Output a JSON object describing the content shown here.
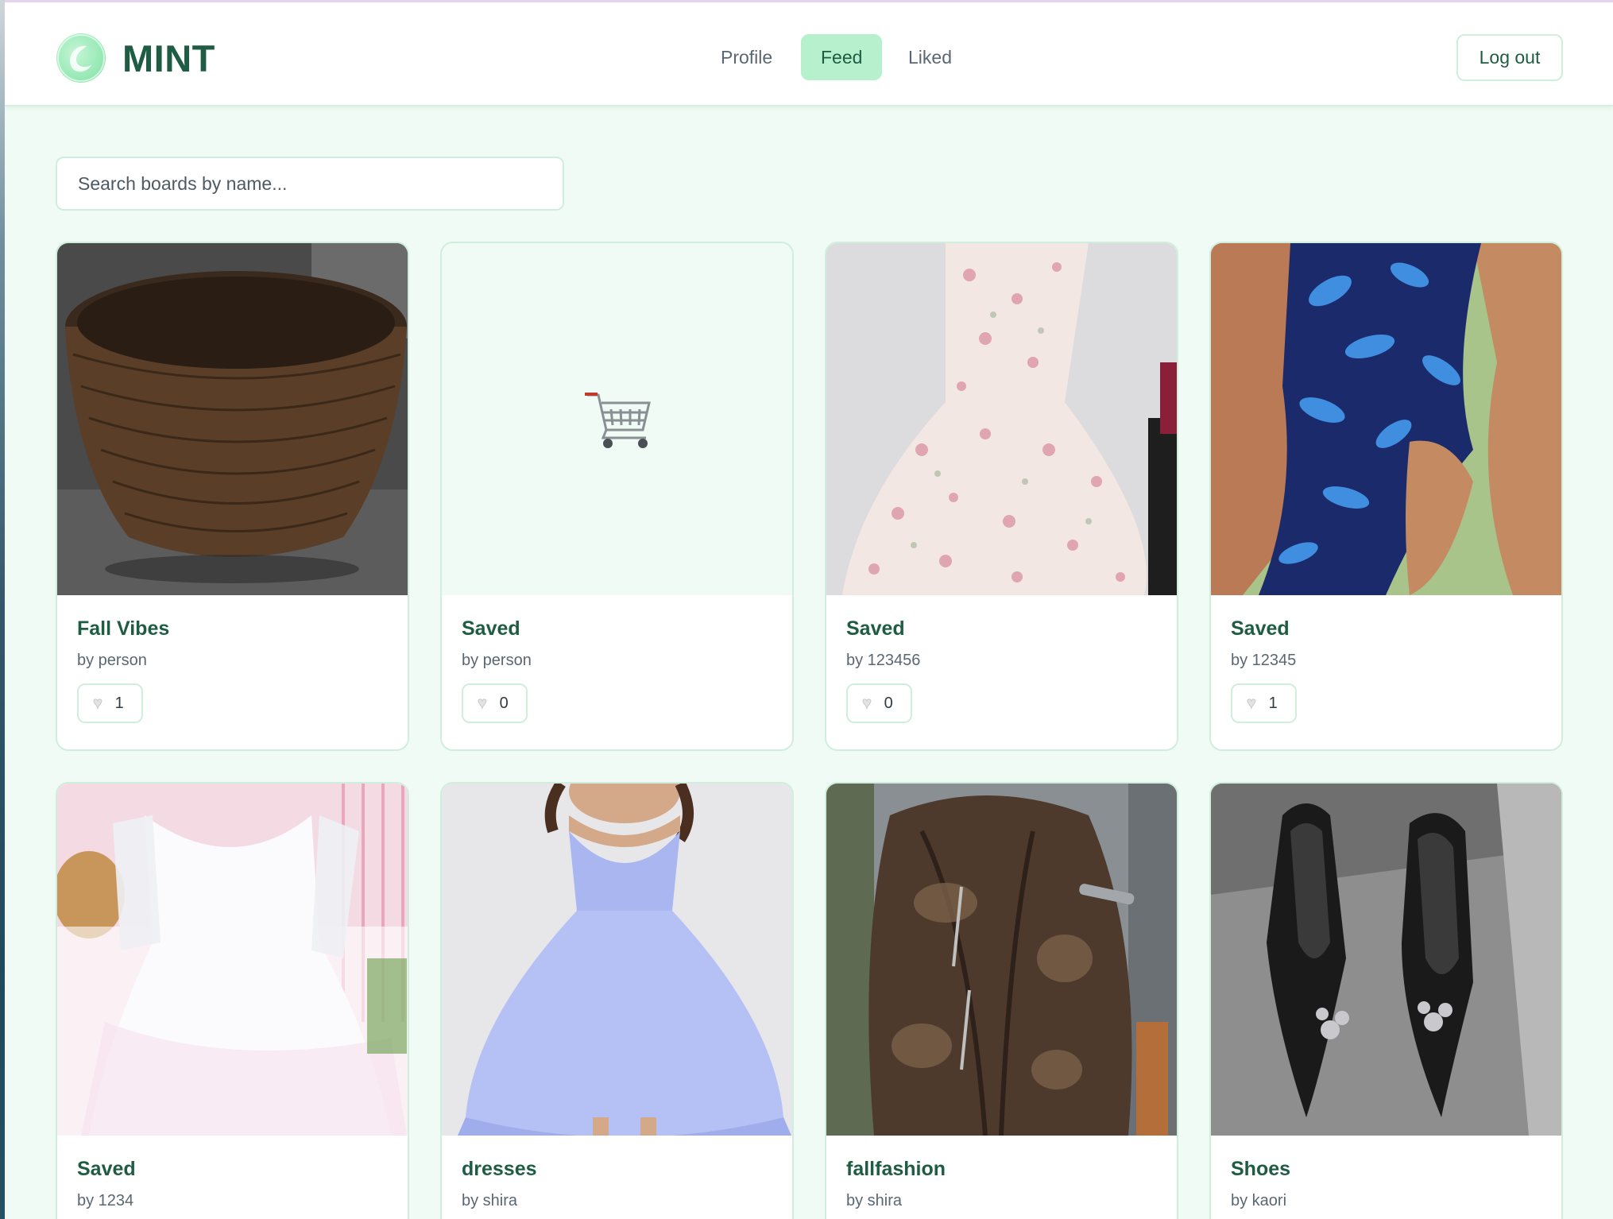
{
  "app": {
    "brand": "MINT",
    "nav": [
      {
        "label": "Profile",
        "active": false
      },
      {
        "label": "Feed",
        "active": true
      },
      {
        "label": "Liked",
        "active": false
      }
    ],
    "logout_label": "Log out"
  },
  "search": {
    "placeholder": "Search boards by name..."
  },
  "boards": [
    {
      "title": "Fall Vibes",
      "author": "by person",
      "likes": "1",
      "image": "wicker-basket"
    },
    {
      "title": "Saved",
      "author": "by person",
      "likes": "0",
      "image": "cart-icon"
    },
    {
      "title": "Saved",
      "author": "by 123456",
      "likes": "0",
      "image": "floral-dress"
    },
    {
      "title": "Saved",
      "author": "by 12345",
      "likes": "1",
      "image": "blue-floral-dress"
    },
    {
      "title": "Saved",
      "author": "by 1234",
      "image": "white-lace-dress"
    },
    {
      "title": "dresses",
      "author": "by shira",
      "image": "lavender-dress"
    },
    {
      "title": "fallfashion",
      "author": "by shira",
      "image": "leather-jacket"
    },
    {
      "title": "Shoes",
      "author": "by kaori",
      "image": "black-heels"
    }
  ],
  "colors": {
    "accent": "#b6f0cc",
    "brand_text": "#1f5c44",
    "page_bg": "#effbf4",
    "border": "#cfeedd"
  }
}
